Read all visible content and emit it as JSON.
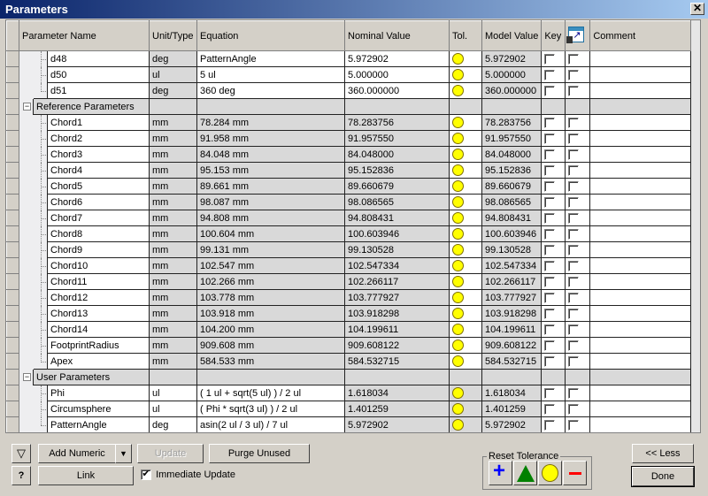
{
  "window": {
    "title": "Parameters"
  },
  "columns": [
    "Parameter Name",
    "Unit/Type",
    "Equation",
    "Nominal Value",
    "Tol.",
    "Model Value",
    "Key",
    "",
    "Comment"
  ],
  "export_icon": "export-parameters-icon",
  "rows": [
    {
      "type": "param",
      "group": "model",
      "name": "d48",
      "unit": "deg",
      "equation": "PatternAngle",
      "nominal": "5.972902",
      "model": "5.972902"
    },
    {
      "type": "param",
      "group": "model",
      "name": "d50",
      "unit": "ul",
      "equation": "5 ul",
      "nominal": "5.000000",
      "model": "5.000000"
    },
    {
      "type": "param",
      "group": "model",
      "name": "d51",
      "unit": "deg",
      "equation": "360 deg",
      "nominal": "360.000000",
      "model": "360.000000",
      "last": true
    },
    {
      "type": "group",
      "name": "Reference Parameters"
    },
    {
      "type": "param",
      "group": "ref",
      "name": "Chord1",
      "unit": "mm",
      "equation": "78.284 mm",
      "nominal": "78.283756",
      "model": "78.283756"
    },
    {
      "type": "param",
      "group": "ref",
      "name": "Chord2",
      "unit": "mm",
      "equation": "91.958 mm",
      "nominal": "91.957550",
      "model": "91.957550"
    },
    {
      "type": "param",
      "group": "ref",
      "name": "Chord3",
      "unit": "mm",
      "equation": "84.048 mm",
      "nominal": "84.048000",
      "model": "84.048000"
    },
    {
      "type": "param",
      "group": "ref",
      "name": "Chord4",
      "unit": "mm",
      "equation": "95.153 mm",
      "nominal": "95.152836",
      "model": "95.152836"
    },
    {
      "type": "param",
      "group": "ref",
      "name": "Chord5",
      "unit": "mm",
      "equation": "89.661 mm",
      "nominal": "89.660679",
      "model": "89.660679"
    },
    {
      "type": "param",
      "group": "ref",
      "name": "Chord6",
      "unit": "mm",
      "equation": "98.087 mm",
      "nominal": "98.086565",
      "model": "98.086565"
    },
    {
      "type": "param",
      "group": "ref",
      "name": "Chord7",
      "unit": "mm",
      "equation": "94.808 mm",
      "nominal": "94.808431",
      "model": "94.808431"
    },
    {
      "type": "param",
      "group": "ref",
      "name": "Chord8",
      "unit": "mm",
      "equation": "100.604 mm",
      "nominal": "100.603946",
      "model": "100.603946"
    },
    {
      "type": "param",
      "group": "ref",
      "name": "Chord9",
      "unit": "mm",
      "equation": "99.131 mm",
      "nominal": "99.130528",
      "model": "99.130528"
    },
    {
      "type": "param",
      "group": "ref",
      "name": "Chord10",
      "unit": "mm",
      "equation": "102.547 mm",
      "nominal": "102.547334",
      "model": "102.547334"
    },
    {
      "type": "param",
      "group": "ref",
      "name": "Chord11",
      "unit": "mm",
      "equation": "102.266 mm",
      "nominal": "102.266117",
      "model": "102.266117"
    },
    {
      "type": "param",
      "group": "ref",
      "name": "Chord12",
      "unit": "mm",
      "equation": "103.778 mm",
      "nominal": "103.777927",
      "model": "103.777927"
    },
    {
      "type": "param",
      "group": "ref",
      "name": "Chord13",
      "unit": "mm",
      "equation": "103.918 mm",
      "nominal": "103.918298",
      "model": "103.918298"
    },
    {
      "type": "param",
      "group": "ref",
      "name": "Chord14",
      "unit": "mm",
      "equation": "104.200 mm",
      "nominal": "104.199611",
      "model": "104.199611"
    },
    {
      "type": "param",
      "group": "ref",
      "name": "FootprintRadius",
      "unit": "mm",
      "equation": "909.608 mm",
      "nominal": "909.608122",
      "model": "909.608122"
    },
    {
      "type": "param",
      "group": "ref",
      "name": "Apex",
      "unit": "mm",
      "equation": "584.533 mm",
      "nominal": "584.532715",
      "model": "584.532715",
      "last": true
    },
    {
      "type": "group",
      "name": "User Parameters"
    },
    {
      "type": "param",
      "group": "user",
      "name": "Phi",
      "unit": "ul",
      "equation": "( 1 ul + sqrt(5 ul) ) / 2 ul",
      "nominal": "1.618034",
      "model": "1.618034"
    },
    {
      "type": "param",
      "group": "user",
      "name": "Circumsphere",
      "unit": "ul",
      "equation": "( Phi * sqrt(3 ul) ) / 2 ul",
      "nominal": "1.401259",
      "model": "1.401259"
    },
    {
      "type": "param",
      "group": "user",
      "name": "PatternAngle",
      "unit": "deg",
      "equation": "asin(2 ul / 3 ul) / 7 ul",
      "nominal": "5.972902",
      "model": "5.972902",
      "last": true
    }
  ],
  "toolbar": {
    "add_numeric": "Add Numeric",
    "update": "Update",
    "purge_unused": "Purge Unused",
    "link": "Link",
    "immediate_update": "Immediate Update",
    "immediate_update_checked": true,
    "reset_tolerance": "Reset Tolerance",
    "less": "<< Less",
    "done": "Done"
  },
  "colors": {
    "tolerance": "#ffff00",
    "plus": "#0000ff",
    "triangle": "#008000",
    "minus": "#ff0000"
  }
}
